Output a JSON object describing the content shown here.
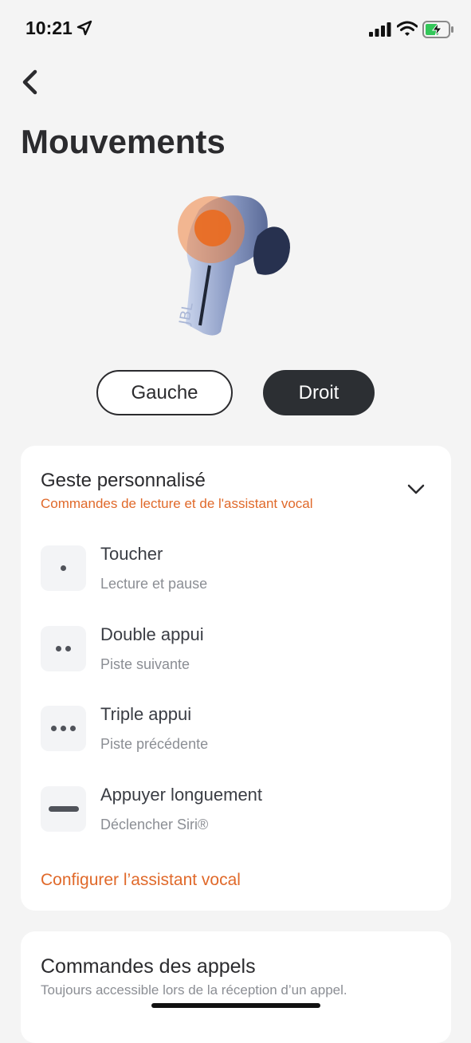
{
  "status": {
    "time": "10:21",
    "icons": [
      "location-arrow-icon",
      "signal-icon",
      "wifi-icon",
      "battery-charging-icon"
    ]
  },
  "header": {
    "back_icon": "chevron-left-icon",
    "title": "Mouvements"
  },
  "side_selector": {
    "left_label": "Gauche",
    "right_label": "Droit",
    "selected": "Droit"
  },
  "gesture_card": {
    "title": "Geste personnalisé",
    "subtitle": "Commandes de lecture et de l'assistant vocal",
    "expand_icon": "chevron-down-icon",
    "gestures": [
      {
        "icon": "single-dot-icon",
        "name": "Toucher",
        "action": "Lecture et pause"
      },
      {
        "icon": "double-dot-icon",
        "name": "Double appui",
        "action": "Piste suivante"
      },
      {
        "icon": "triple-dot-icon",
        "name": "Triple appui",
        "action": "Piste précédente"
      },
      {
        "icon": "long-press-bar-icon",
        "name": "Appuyer longuement",
        "action": "Déclencher Siri®"
      }
    ],
    "link": "Configurer l’assistant vocal"
  },
  "calls_card": {
    "title": "Commandes des appels",
    "subtitle": "Toujours accessible lors de la réception d’un appel."
  },
  "colors": {
    "accent": "#e0692a",
    "dark_button": "#2c2f33",
    "background": "#f4f4f4",
    "card": "#ffffff"
  }
}
